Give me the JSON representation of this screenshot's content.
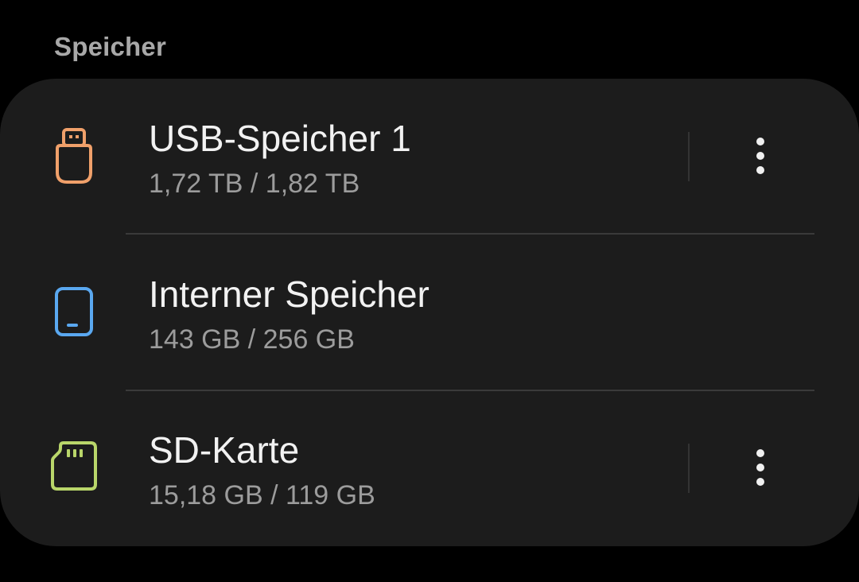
{
  "section": {
    "title": "Speicher"
  },
  "storage": {
    "items": [
      {
        "title": "USB-Speicher 1",
        "usage": "1,72 TB / 1,82 TB",
        "icon": "usb-drive-icon",
        "icon_color": "#f0a06a",
        "has_menu": true
      },
      {
        "title": "Interner Speicher",
        "usage": "143 GB / 256 GB",
        "icon": "phone-icon",
        "icon_color": "#5aa8f0",
        "has_menu": false
      },
      {
        "title": "SD-Karte",
        "usage": "15,18 GB / 119 GB",
        "icon": "sd-card-icon",
        "icon_color": "#b9d66a",
        "has_menu": true
      }
    ]
  },
  "colors": {
    "background": "#000000",
    "card": "#1c1c1c",
    "title_text": "#f2f2f2",
    "secondary_text": "#9c9c9c"
  }
}
